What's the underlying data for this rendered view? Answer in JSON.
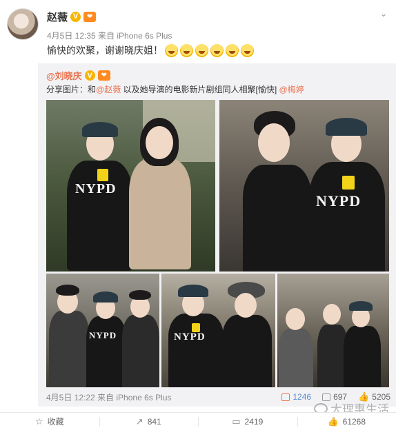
{
  "author": {
    "name": "赵薇",
    "verified_mark": "V",
    "level_badge": "❤",
    "meta": "4月5日 12:35 来自 iPhone 6s Plus",
    "text": "愉快的欢聚，谢谢晓庆姐！",
    "emojis": [
      "laughing-cry",
      "laughing-cry",
      "laughing-cry",
      "grin",
      "grin",
      "grin"
    ]
  },
  "repost": {
    "name": "@刘晓庆",
    "verified_mark": "V",
    "level_badge": "❤",
    "text_prefix": "分享图片：和",
    "mention1": "@赵薇",
    "text_middle": " 以及她导演的电影新片剧组同人相聚[愉快] ",
    "mention2": "@梅婷",
    "photos": [
      {
        "label": "photo-1"
      },
      {
        "label": "photo-2"
      },
      {
        "label": "photo-3"
      },
      {
        "label": "photo-4"
      },
      {
        "label": "photo-5"
      }
    ],
    "nypd": "NYPD",
    "date": "4月5日 12:22 来自 iPhone 6s Plus",
    "stats": {
      "reposts": "1246",
      "comments": "697",
      "likes": "5205"
    }
  },
  "footer": {
    "favorite": "收藏",
    "reposts": "841",
    "comments": "2419",
    "likes": "61268"
  },
  "watermark": "大理惠生活",
  "colors": {
    "accent_orange": "#eb7350",
    "link_blue": "#5a8bd0",
    "repost_bg": "#f2f2f5"
  }
}
